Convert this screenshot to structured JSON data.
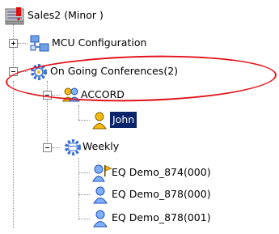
{
  "root": {
    "label": "Sales2  (Minor )",
    "icon": "server-warning-icon"
  },
  "items": [
    {
      "label": "MCU Configuration",
      "icon": "network-config-icon",
      "expander": "plus"
    },
    {
      "label": "On Going Conferences(2)",
      "icon": "conferences-gear-icon",
      "expander": "minus"
    },
    {
      "label": "ACCORD",
      "icon": "conference-group-icon",
      "expander": "minus"
    },
    {
      "label": "John",
      "icon": "participant-icon",
      "selected": true
    },
    {
      "label": "Weekly",
      "icon": "conference-schedule-icon",
      "expander": "minus"
    },
    {
      "label": "EQ Demo_874(000)",
      "icon": "participant-flag-icon"
    },
    {
      "label": "EQ Demo_878(000)",
      "icon": "participant-icon"
    },
    {
      "label": "EQ Demo_878(001)",
      "icon": "participant-icon"
    }
  ],
  "colors": {
    "selection": "#0a246a",
    "callout": "#e0141b",
    "participant_yellow": "#f2b90f",
    "participant_blue": "#2f6fd6"
  }
}
